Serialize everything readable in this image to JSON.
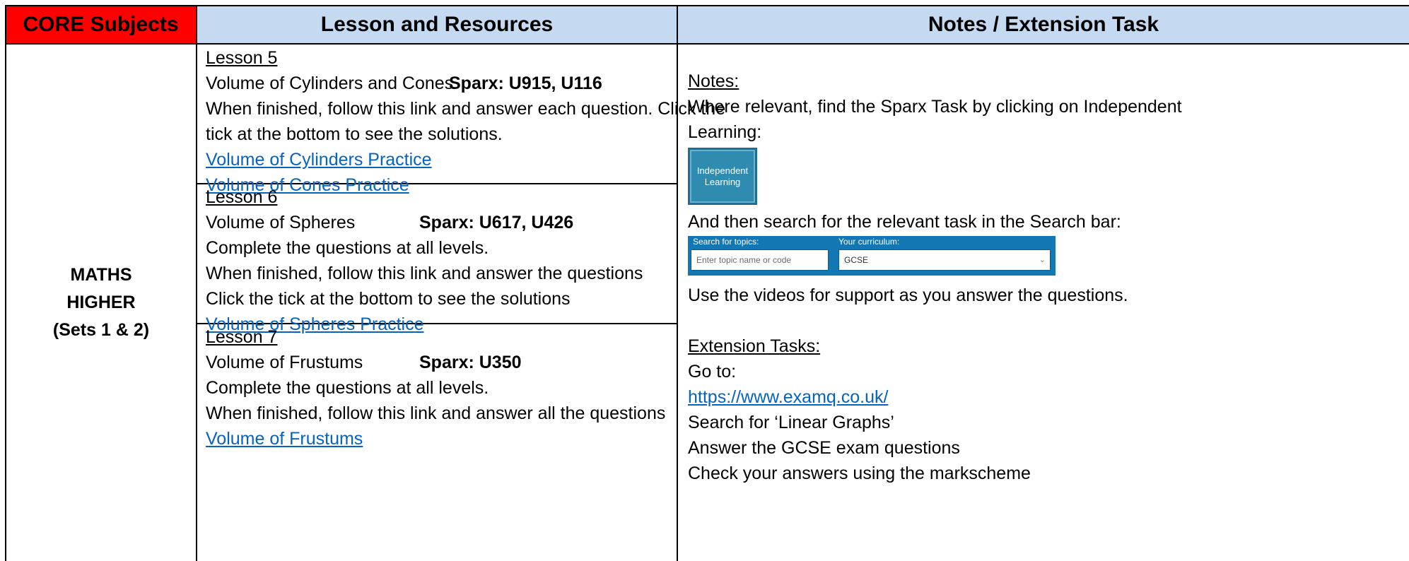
{
  "header": {
    "core": "CORE Subjects",
    "lesson": "Lesson and Resources",
    "notes": "Notes / Extension Task"
  },
  "subject": {
    "line1": "MATHS",
    "line2": "HIGHER",
    "line3": "(Sets 1 & 2)"
  },
  "lessons": [
    {
      "title": "Lesson 5",
      "topic": "Volume of Cylinders and Cones",
      "sparx": "Sparx: U915, U116",
      "text1": "When finished, follow this link and answer each question. Click the",
      "text2": "tick at the bottom to see the solutions.",
      "link1": "Volume of Cylinders Practice",
      "link2": "Volume of Cones Practice"
    },
    {
      "title": "Lesson 6",
      "topic": "Volume of Spheres",
      "sparx": "Sparx: U617, U426",
      "text1": "Complete the questions at all levels.",
      "text2": "When finished, follow this link and answer the questions",
      "text3": "Click the tick at the bottom to see the solutions",
      "link1": "Volume of Spheres Practice"
    },
    {
      "title": "Lesson 7",
      "topic": "Volume of Frustums",
      "sparx": "Sparx: U350",
      "text1": "Complete the questions at all levels.",
      "text2": "When finished, follow this link and answer all the questions",
      "link1": "Volume of Frustums"
    }
  ],
  "notes": {
    "heading": "Notes:",
    "line1": "Where relevant, find the Sparx Task by clicking on Independent",
    "line2": "Learning:",
    "tile": {
      "line1": "Independent",
      "line2": "Learning",
      "icon": "independent-learning-tile"
    },
    "search_line": "And then search for the relevant task in the Search bar:",
    "search_widget": {
      "topics_label": "Search for topics:",
      "curriculum_label": "Your curriculum:",
      "placeholder": "Enter topic name or code",
      "curriculum_value": "GCSE",
      "chevron": "⌄"
    },
    "videos_line": "Use the videos for support as you answer the questions.",
    "ext_heading": "Extension Tasks:",
    "goto": "Go to:",
    "url": "https://www.examq.co.uk/",
    "search_for": "Search for ‘Linear Graphs’",
    "answer": "Answer the GCSE exam questions",
    "check": "Check your answers using the markscheme"
  },
  "colors": {
    "core_header": "#ff0000",
    "blue_header": "#c5d9f1",
    "link": "#0563c1",
    "sparx_blue": "#1377b4"
  }
}
